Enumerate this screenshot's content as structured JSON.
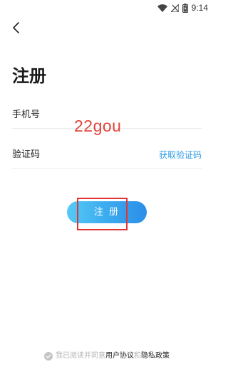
{
  "status_bar": {
    "time": "9:14",
    "icons": [
      "wifi-icon",
      "signal-off-icon",
      "battery-charging-icon"
    ]
  },
  "nav": {
    "back_icon": "chevron-left-icon"
  },
  "page": {
    "title": "注册"
  },
  "form": {
    "phone_label": "手机号",
    "phone_value": "",
    "code_label": "验证码",
    "code_value": "",
    "get_code_label": "获取验证码"
  },
  "watermark": "22gou",
  "register_button": {
    "label": "注 册"
  },
  "agreement": {
    "prefix": "我已阅读并同意",
    "user_agreement": "用户协议",
    "and": "和",
    "privacy_policy": "隐私政策"
  },
  "colors": {
    "accent": "#2e9be6",
    "button_gradient_start": "#54c9f5",
    "button_gradient_end": "#2b8ee8",
    "highlight": "#e03535",
    "watermark": "#e0443a"
  }
}
